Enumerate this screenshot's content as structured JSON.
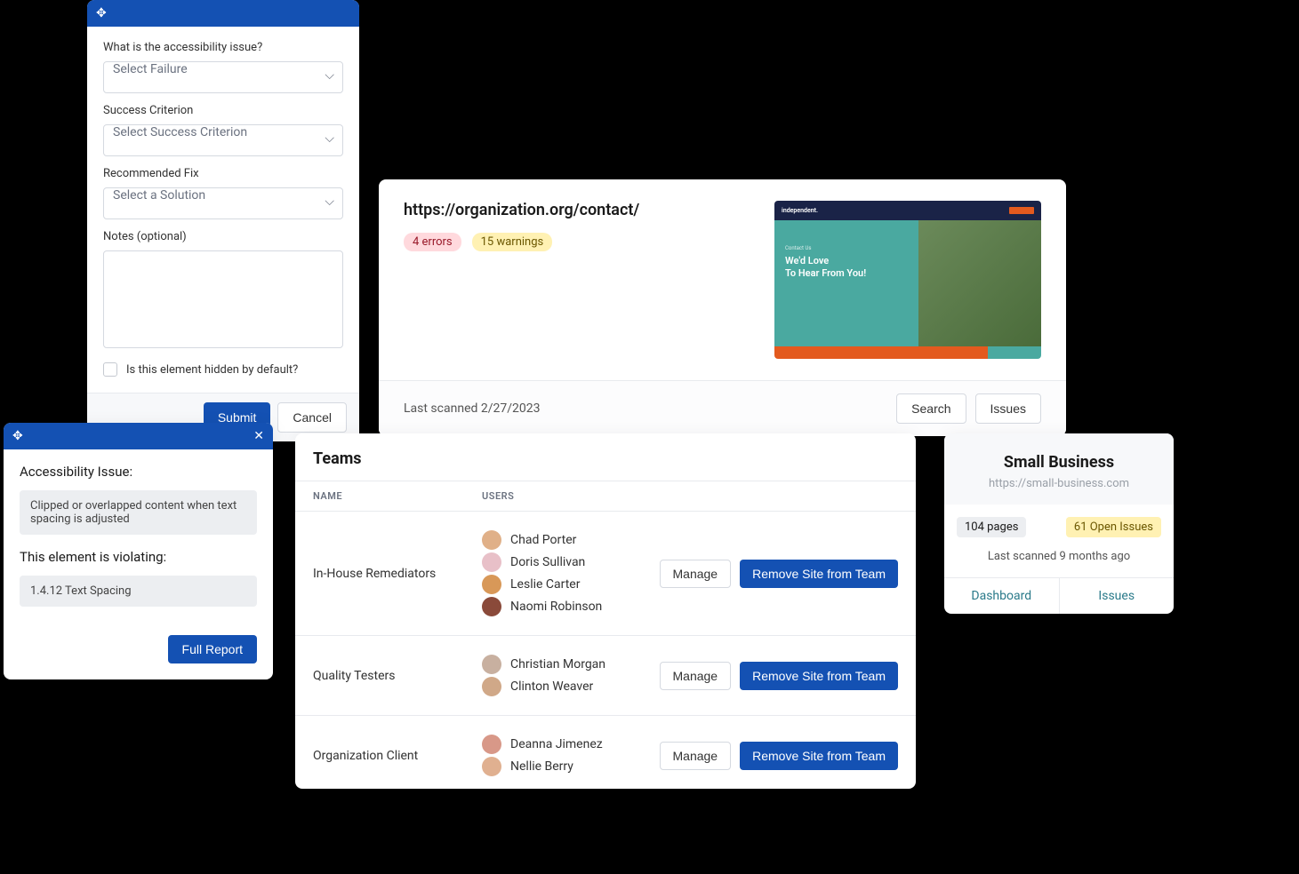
{
  "form": {
    "q1": "What is the accessibility issue?",
    "sel1": "Select Failure",
    "q2": "Success Criterion",
    "sel2": "Select Success Criterion",
    "q3": "Recommended Fix",
    "sel3": "Select a Solution",
    "q4": "Notes (optional)",
    "chk": "Is this element hidden by default?",
    "submit": "Submit",
    "cancel": "Cancel"
  },
  "issue": {
    "h1": "Accessibility Issue:",
    "desc": "Clipped or overlapped content when text spacing is adjusted",
    "h2": "This element is violating:",
    "rule": "1.4.12 Text Spacing",
    "btn": "Full Report"
  },
  "scan": {
    "url": "https://organization.org/contact/",
    "errors": "4 errors",
    "warnings": "15 warnings",
    "preview": {
      "logo": "independent.",
      "sub": "Contact Us",
      "heading": "We'd Love\nTo Hear From You!"
    },
    "lastScanned": "Last scanned 2/27/2023",
    "search": "Search",
    "issues": "Issues"
  },
  "teams": {
    "title": "Teams",
    "colName": "NAME",
    "colUsers": "USERS",
    "manage": "Manage",
    "remove": "Remove Site from Team",
    "rows": [
      {
        "name": "In-House Remediators",
        "users": [
          "Chad Porter",
          "Doris Sullivan",
          "Leslie Carter",
          "Naomi Robinson"
        ],
        "av": [
          "#e0b088",
          "#e8c0c8",
          "#d89858",
          "#8a4a3a"
        ]
      },
      {
        "name": "Quality Testers",
        "users": [
          "Christian Morgan",
          "Clinton Weaver"
        ],
        "av": [
          "#c8b0a0",
          "#d0a888"
        ]
      },
      {
        "name": "Organization Client",
        "users": [
          "Deanna Jimenez",
          "Nellie Berry"
        ],
        "av": [
          "#d89888",
          "#e0b090"
        ]
      }
    ]
  },
  "sb": {
    "title": "Small Business",
    "url": "https://small-business.com",
    "pages": "104 pages",
    "issues": "61 Open Issues",
    "date": "Last scanned 9 months ago",
    "dash": "Dashboard",
    "iss": "Issues"
  }
}
